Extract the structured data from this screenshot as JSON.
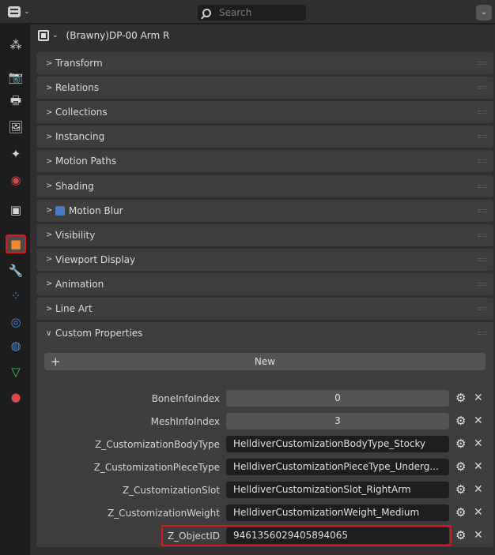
{
  "header": {
    "search_placeholder": "Search",
    "editor_type_icon": "properties-editor-icon",
    "right_dropdown_icon": "chevron-down-icon"
  },
  "object_selector": {
    "name": "(Brawny)DP-00 Arm R"
  },
  "tabs": [
    {
      "icon": "tool-icon",
      "glyph": "⁂",
      "color": "#d6d6d6"
    },
    {
      "icon": "render-icon",
      "glyph": "📷",
      "color": "#d6d6d6"
    },
    {
      "icon": "output-icon",
      "glyph": "🖶",
      "color": "#d6d6d6"
    },
    {
      "icon": "view-layer-icon",
      "glyph": "🖼",
      "color": "#d6d6d6"
    },
    {
      "icon": "scene-icon",
      "glyph": "✦",
      "color": "#d6d6d6"
    },
    {
      "icon": "world-icon",
      "glyph": "◉",
      "color": "#d84a4a"
    },
    {
      "icon": "collection-icon",
      "glyph": "▣",
      "color": "#d6d6d6"
    },
    {
      "icon": "object-icon",
      "glyph": "■",
      "color": "#f08a2c"
    },
    {
      "icon": "modifier-icon",
      "glyph": "🔧",
      "color": "#4a90e2"
    },
    {
      "icon": "particles-icon",
      "glyph": "⁘",
      "color": "#4a90e2"
    },
    {
      "icon": "physics-icon",
      "glyph": "◎",
      "color": "#4a90e2"
    },
    {
      "icon": "constraints-icon",
      "glyph": "◍",
      "color": "#4a90e2"
    },
    {
      "icon": "data-icon",
      "glyph": "▽",
      "color": "#3ec46d"
    },
    {
      "icon": "material-icon",
      "glyph": "●",
      "color": "#d84a4a"
    }
  ],
  "panels": [
    {
      "label": "Transform",
      "open": false,
      "checkbox": false
    },
    {
      "label": "Relations",
      "open": false,
      "checkbox": false
    },
    {
      "label": "Collections",
      "open": false,
      "checkbox": false
    },
    {
      "label": "Instancing",
      "open": false,
      "checkbox": false
    },
    {
      "label": "Motion Paths",
      "open": false,
      "checkbox": false
    },
    {
      "label": "Shading",
      "open": false,
      "checkbox": false
    },
    {
      "label": "Motion Blur",
      "open": false,
      "checkbox": true
    },
    {
      "label": "Visibility",
      "open": false,
      "checkbox": false
    },
    {
      "label": "Viewport Display",
      "open": false,
      "checkbox": false
    },
    {
      "label": "Animation",
      "open": false,
      "checkbox": false
    },
    {
      "label": "Line Art",
      "open": false,
      "checkbox": false
    },
    {
      "label": "Custom Properties",
      "open": true,
      "checkbox": false
    }
  ],
  "custom_properties": {
    "new_button": "New",
    "items": [
      {
        "name": "BoneInfoIndex",
        "value": "0",
        "numeric": true,
        "highlighted": false
      },
      {
        "name": "MeshInfoIndex",
        "value": "3",
        "numeric": true,
        "highlighted": false
      },
      {
        "name": "Z_CustomizationBodyType",
        "value": "HelldiverCustomizationBodyType_Stocky",
        "numeric": false,
        "highlighted": false
      },
      {
        "name": "Z_CustomizationPieceType",
        "value": "HelldiverCustomizationPieceType_Underg...",
        "numeric": false,
        "highlighted": false
      },
      {
        "name": "Z_CustomizationSlot",
        "value": "HelldiverCustomizationSlot_RightArm",
        "numeric": false,
        "highlighted": false
      },
      {
        "name": "Z_CustomizationWeight",
        "value": "HelldiverCustomizationWeight_Medium",
        "numeric": false,
        "highlighted": false
      },
      {
        "name": "Z_ObjectID",
        "value": "9461356029405894065",
        "numeric": false,
        "highlighted": true
      }
    ]
  },
  "colors": {
    "highlight_red": "#e0141e",
    "checkbox_blue": "#4a78c6"
  }
}
